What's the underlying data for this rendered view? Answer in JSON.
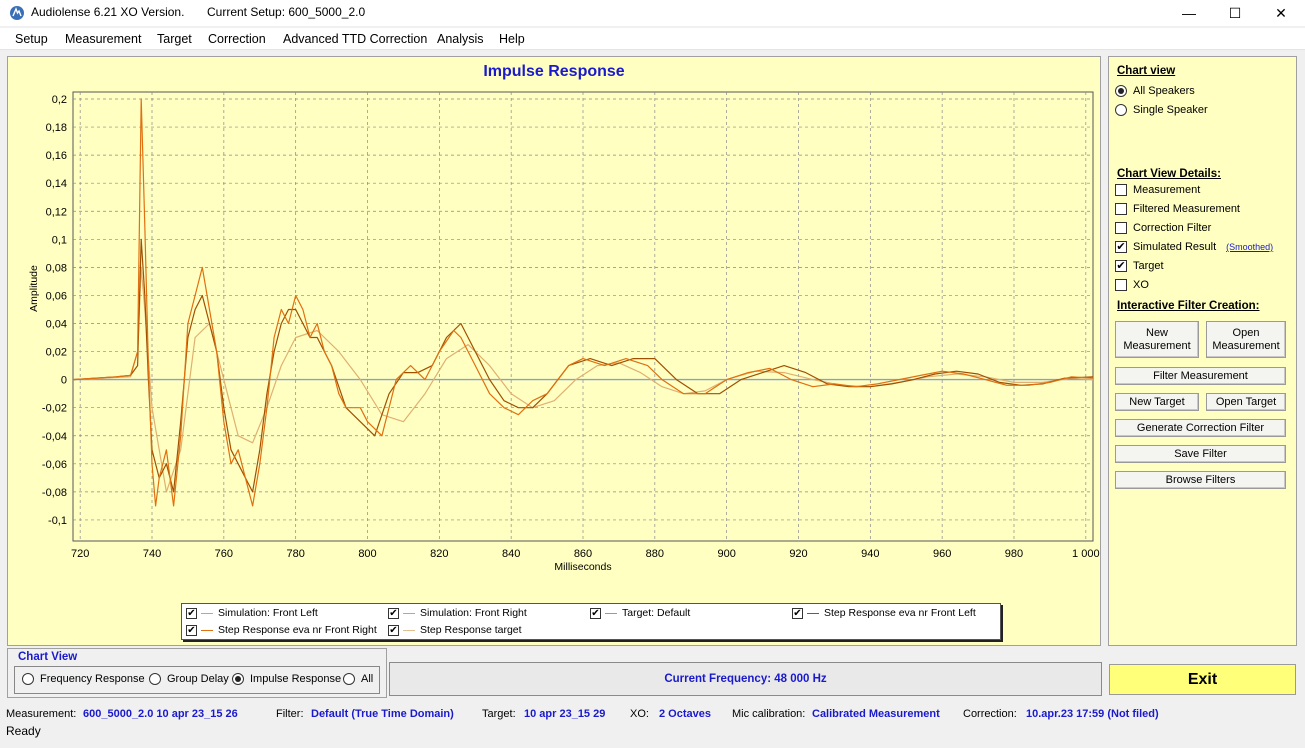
{
  "window": {
    "app_title": "Audiolense 6.21 XO Version.",
    "setup_title": "Current Setup: 600_5000_2.0",
    "minimize": "—",
    "maximize": "☐",
    "close": "✕"
  },
  "menu": [
    "Setup",
    "Measurement",
    "Target",
    "Correction",
    "Advanced TTD Correction",
    "Analysis",
    "Help"
  ],
  "chart_data": {
    "type": "line",
    "title": "Impulse Response",
    "xlabel": "Milliseconds",
    "ylabel": "Amplitude",
    "xlim": [
      718,
      1002
    ],
    "ylim": [
      -0.115,
      0.205
    ],
    "x_ticks": [
      720,
      740,
      760,
      780,
      800,
      820,
      840,
      860,
      880,
      900,
      920,
      940,
      960,
      980,
      1000
    ],
    "x_tick_labels": [
      "720",
      "740",
      "760",
      "780",
      "800",
      "820",
      "840",
      "860",
      "880",
      "900",
      "920",
      "940",
      "960",
      "980",
      "1 000"
    ],
    "y_ticks": [
      0.2,
      0.18,
      0.16,
      0.14,
      0.12,
      0.1,
      0.08,
      0.06,
      0.04,
      0.02,
      0,
      -0.02,
      -0.04,
      -0.06,
      -0.08,
      -0.1
    ],
    "y_tick_labels": [
      "0,2",
      "0,18",
      "0,16",
      "0,14",
      "0,12",
      "0,1",
      "0,08",
      "0,06",
      "0,04",
      "0,02",
      "0",
      "-0,02",
      "-0,04",
      "-0,06",
      "-0,08",
      "-0,1"
    ],
    "grid": true,
    "series": [
      {
        "name": "Simulation: Front Left",
        "color": "#e07010",
        "x": [
          718,
          730,
          734,
          736,
          737,
          738,
          739,
          740,
          741,
          742,
          744,
          746,
          748,
          750,
          752,
          754,
          756,
          758,
          760,
          762,
          764,
          766,
          768,
          770,
          772,
          774,
          776,
          778,
          780,
          782,
          784,
          786,
          788,
          790,
          792,
          794,
          796,
          798,
          800,
          804,
          808,
          812,
          816,
          820,
          824,
          826,
          830,
          834,
          838,
          842,
          846,
          850,
          856,
          860,
          866,
          872,
          878,
          882,
          888,
          894,
          900,
          906,
          912,
          918,
          924,
          930,
          936,
          942,
          948,
          954,
          960,
          966,
          972,
          978,
          984,
          990,
          996,
          1002
        ],
        "y": [
          0,
          0.002,
          0.003,
          0.02,
          0.2,
          0.11,
          0.01,
          -0.06,
          -0.09,
          -0.07,
          -0.05,
          -0.09,
          -0.04,
          0.04,
          0.06,
          0.08,
          0.05,
          0.02,
          -0.03,
          -0.06,
          -0.05,
          -0.07,
          -0.09,
          -0.06,
          -0.02,
          0.03,
          0.05,
          0.04,
          0.06,
          0.05,
          0.03,
          0.04,
          0.02,
          0.01,
          -0.01,
          -0.02,
          -0.02,
          -0.02,
          -0.03,
          -0.04,
          0.0,
          0.01,
          0.0,
          0.02,
          0.035,
          0.03,
          0.01,
          -0.01,
          -0.02,
          -0.025,
          -0.015,
          -0.01,
          0.01,
          0.015,
          0.01,
          0.015,
          0.01,
          0.0,
          -0.01,
          -0.01,
          0.0,
          0.005,
          0.008,
          0.0,
          -0.005,
          -0.003,
          -0.005,
          -0.003,
          0.0,
          0.003,
          0.006,
          0.004,
          0.0,
          -0.004,
          -0.004,
          -0.002,
          0.002,
          0.001
        ]
      },
      {
        "name": "Step Response eva nr Front Left",
        "color": "#a05000",
        "x": [
          718,
          730,
          734,
          736,
          737,
          738,
          739,
          740,
          742,
          744,
          746,
          748,
          750,
          752,
          754,
          756,
          758,
          760,
          762,
          764,
          766,
          768,
          770,
          772,
          774,
          776,
          778,
          780,
          782,
          784,
          786,
          788,
          790,
          794,
          798,
          802,
          806,
          810,
          814,
          818,
          822,
          826,
          830,
          834,
          838,
          842,
          846,
          850,
          856,
          862,
          868,
          874,
          880,
          886,
          892,
          898,
          904,
          910,
          916,
          922,
          928,
          934,
          940,
          946,
          952,
          958,
          964,
          970,
          976,
          982,
          988,
          994,
          1002
        ],
        "y": [
          0,
          0.002,
          0.003,
          0.01,
          0.1,
          0.06,
          0.0,
          -0.05,
          -0.07,
          -0.06,
          -0.08,
          -0.03,
          0.03,
          0.05,
          0.06,
          0.04,
          0.02,
          -0.02,
          -0.05,
          -0.06,
          -0.07,
          -0.08,
          -0.05,
          -0.01,
          0.02,
          0.04,
          0.05,
          0.05,
          0.04,
          0.03,
          0.03,
          0.02,
          0.01,
          -0.02,
          -0.03,
          -0.04,
          -0.01,
          0.005,
          0.005,
          0.01,
          0.03,
          0.04,
          0.02,
          0.0,
          -0.015,
          -0.02,
          -0.02,
          -0.01,
          0.01,
          0.015,
          0.01,
          0.015,
          0.015,
          0.0,
          -0.01,
          -0.01,
          0.0,
          0.005,
          0.01,
          0.005,
          -0.003,
          -0.005,
          -0.005,
          -0.003,
          0.0,
          0.004,
          0.006,
          0.004,
          -0.002,
          -0.004,
          -0.003,
          0.001,
          0.002
        ]
      },
      {
        "name": "Step Response target",
        "color": "#e0b070",
        "x": [
          718,
          734,
          736,
          737,
          738,
          740,
          744,
          748,
          752,
          756,
          760,
          764,
          768,
          772,
          776,
          780,
          786,
          792,
          798,
          804,
          810,
          816,
          822,
          828,
          834,
          840,
          846,
          852,
          858,
          864,
          870,
          876,
          882,
          888,
          894,
          900,
          908,
          916,
          924,
          932,
          940,
          948,
          956,
          964,
          972,
          980,
          988,
          996,
          1002
        ],
        "y": [
          0,
          0.002,
          0.02,
          0.08,
          0.05,
          -0.02,
          -0.08,
          -0.05,
          0.03,
          0.04,
          0.0,
          -0.04,
          -0.045,
          -0.02,
          0.01,
          0.03,
          0.035,
          0.02,
          0.0,
          -0.025,
          -0.03,
          -0.01,
          0.015,
          0.025,
          0.01,
          -0.01,
          -0.02,
          -0.015,
          0.0,
          0.01,
          0.012,
          0.005,
          -0.005,
          -0.01,
          -0.008,
          0.0,
          0.006,
          0.005,
          0.0,
          -0.004,
          -0.005,
          -0.002,
          0.002,
          0.004,
          0.002,
          -0.002,
          -0.002,
          0.001,
          0.0
        ]
      },
      {
        "name": "Target: Default",
        "color": "#8aa0c8",
        "x": [
          718,
          1002
        ],
        "y": [
          0,
          0
        ]
      }
    ]
  },
  "legend": {
    "items": [
      {
        "label": "Simulation: Front Left",
        "color": "#e89090",
        "check": "✔"
      },
      {
        "label": "Simulation: Front Right",
        "color": "#e89090",
        "check": "✔"
      },
      {
        "label": "Target: Default",
        "color": "#9a9a9a",
        "check": "✔"
      },
      {
        "label": "Step Response eva nr Front Left",
        "color": "#a05000",
        "check": "✔"
      },
      {
        "label": "Step Response eva nr Front Right",
        "color": "#e07010",
        "check": "✔"
      },
      {
        "label": "Step Response target",
        "color": "#e0c090",
        "check": "✔"
      }
    ]
  },
  "side": {
    "chart_view_head": "Chart view",
    "all_speakers": "All Speakers",
    "single_speaker": "Single Speaker",
    "details_head": "Chart View Details:",
    "measurement": "Measurement",
    "filtered_measurement": "Filtered Measurement",
    "correction_filter": "Correction Filter",
    "simulated_result": "Simulated Result",
    "smoothed": "(Smoothed)",
    "target": "Target",
    "xo": "XO",
    "checkmark": "✔",
    "interactive_head": "Interactive Filter Creation:",
    "new_measurement": "New Measurement",
    "open_measurement": "Open Measurement",
    "filter_measurement": "Filter Measurement",
    "new_target": "New Target",
    "open_target": "Open Target",
    "generate_correction_filter": "Generate Correction Filter",
    "save_filter": "Save Filter",
    "browse_filters": "Browse Filters"
  },
  "view": {
    "legend": "Chart View",
    "frequency_response": "Frequency Response",
    "group_delay": "Group Delay",
    "impulse_response": "Impulse Response",
    "all": "All",
    "selected": "Impulse Response"
  },
  "current_frequency": "Current Frequency: 48 000 Hz",
  "exit": "Exit",
  "status": {
    "measurement_label": "Measurement:",
    "measurement_value": "600_5000_2.0 10 apr 23_15 26",
    "filter_label": "Filter:",
    "filter_value": "Default (True Time Domain)",
    "target_label": "Target:",
    "target_value": "10 apr 23_15 29",
    "xo_label": "XO:",
    "xo_value": "2 Octaves",
    "mic_label": "Mic calibration:",
    "mic_value": "Calibrated Measurement",
    "correction_label": "Correction:",
    "correction_value": "10.apr.23 17:59 (Not filed)",
    "ready": "Ready"
  }
}
